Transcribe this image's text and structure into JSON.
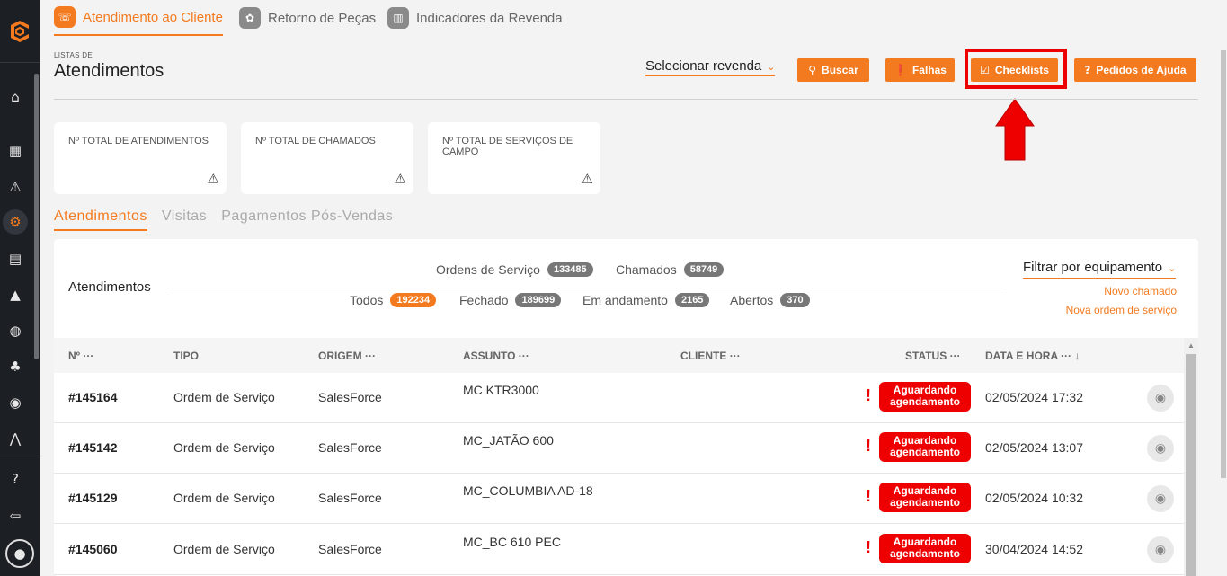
{
  "nav_tabs": [
    {
      "label": "Atendimento ao Cliente",
      "active": true
    },
    {
      "label": "Retorno de Peças",
      "active": false
    },
    {
      "label": "Indicadores da Revenda",
      "active": false
    }
  ],
  "header": {
    "small_label": "LISTAS DE",
    "title": "Atendimentos",
    "select_revenda": "Selecionar revenda"
  },
  "buttons": {
    "buscar": "Buscar",
    "falhas": "Falhas",
    "checklists": "Checklists",
    "pedidos": "Pedidos de Ajuda"
  },
  "cards": [
    {
      "label": "Nº TOTAL DE ATENDIMENTOS"
    },
    {
      "label": "Nº TOTAL DE CHAMADOS"
    },
    {
      "label": "Nº TOTAL DE SERVIÇOS DE CAMPO"
    }
  ],
  "subtabs": [
    {
      "label": "Atendimentos",
      "active": true
    },
    {
      "label": "Visitas",
      "active": false
    },
    {
      "label": "Pagamentos Pós-Vendas",
      "active": false
    }
  ],
  "panel": {
    "title": "Atendimentos",
    "stats_row1": [
      {
        "label": "Ordens de Serviço",
        "count": "133485"
      },
      {
        "label": "Chamados",
        "count": "58749"
      }
    ],
    "stats_row2": [
      {
        "label": "Todos",
        "count": "192234"
      },
      {
        "label": "Fechado",
        "count": "189699"
      },
      {
        "label": "Em andamento",
        "count": "2165"
      },
      {
        "label": "Abertos",
        "count": "370"
      }
    ],
    "filter": "Filtrar por equipamento",
    "link_novo_chamado": "Novo chamado",
    "link_nova_ordem": "Nova ordem de serviço"
  },
  "table": {
    "columns": {
      "num": "Nº",
      "tipo": "TIPO",
      "origem": "ORIGEM",
      "assunto": "ASSUNTO",
      "cliente": "CLIENTE",
      "status": "STATUS",
      "data": "DATA E HORA"
    },
    "rows": [
      {
        "num": "#145164",
        "tipo": "Ordem de Serviço",
        "origem": "SalesForce",
        "assunto": "MC  KTR3000",
        "status_l1": "Aguardando",
        "status_l2": "agendamento",
        "data": "02/05/2024 17:32"
      },
      {
        "num": "#145142",
        "tipo": "Ordem de Serviço",
        "origem": "SalesForce",
        "assunto": "MC_JATÃO 600",
        "status_l1": "Aguardando",
        "status_l2": "agendamento",
        "data": "02/05/2024 13:07"
      },
      {
        "num": "#145129",
        "tipo": "Ordem de Serviço",
        "origem": "SalesForce",
        "assunto": "MC_COLUMBIA AD-18",
        "status_l1": "Aguardando",
        "status_l2": "agendamento",
        "data": "02/05/2024 10:32"
      },
      {
        "num": "#145060",
        "tipo": "Ordem de Serviço",
        "origem": "SalesForce",
        "assunto": "MC_BC 610 PEC",
        "status_l1": "Aguardando",
        "status_l2": "agendamento",
        "data": "30/04/2024 14:52"
      }
    ]
  },
  "colors": {
    "accent": "#f47a1f",
    "sidebar": "#1c1f24",
    "status_red": "#e00000",
    "annotation_red": "#ee0000"
  },
  "icons": {
    "dots": "···",
    "sort_down": "↓"
  }
}
